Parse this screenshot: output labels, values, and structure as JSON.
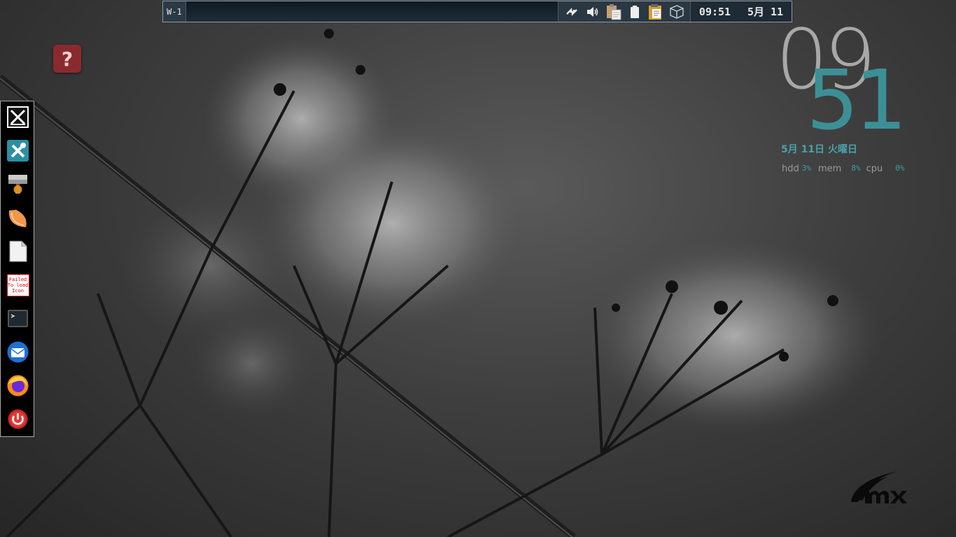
{
  "top_panel": {
    "workspace_label": "W-1",
    "tray_icons": [
      "network-icon",
      "volume-icon",
      "clipboard-icon",
      "battery-icon",
      "clipboard-manager-icon",
      "package-icon"
    ],
    "clock_time": "09:51",
    "clock_date": "5月 11"
  },
  "desktop": {
    "help_icon_glyph": "?"
  },
  "dock": {
    "items": [
      {
        "name": "mx-tweak-icon"
      },
      {
        "name": "mx-tools-icon"
      },
      {
        "name": "file-manager-icon"
      },
      {
        "name": "tangerine-icon"
      },
      {
        "name": "document-icon"
      },
      {
        "name": "failed-icon",
        "text": "Failed To load Icon"
      },
      {
        "name": "terminal-icon"
      },
      {
        "name": "thunderbird-icon"
      },
      {
        "name": "firefox-icon"
      },
      {
        "name": "power-icon"
      }
    ]
  },
  "conky": {
    "hour": "09",
    "minute": "51",
    "date": "5月  11日  火曜日",
    "stats": {
      "hdd_label": "hdd",
      "hdd_value": "3%",
      "mem_label": "mem",
      "mem_value": "8%",
      "cpu_label": "cpu",
      "cpu_value": "0%"
    }
  },
  "colors": {
    "conky_accent": "#3d8f96",
    "conky_hour": "#a8a8a8",
    "help_icon_bg": "#8b2a2e"
  }
}
